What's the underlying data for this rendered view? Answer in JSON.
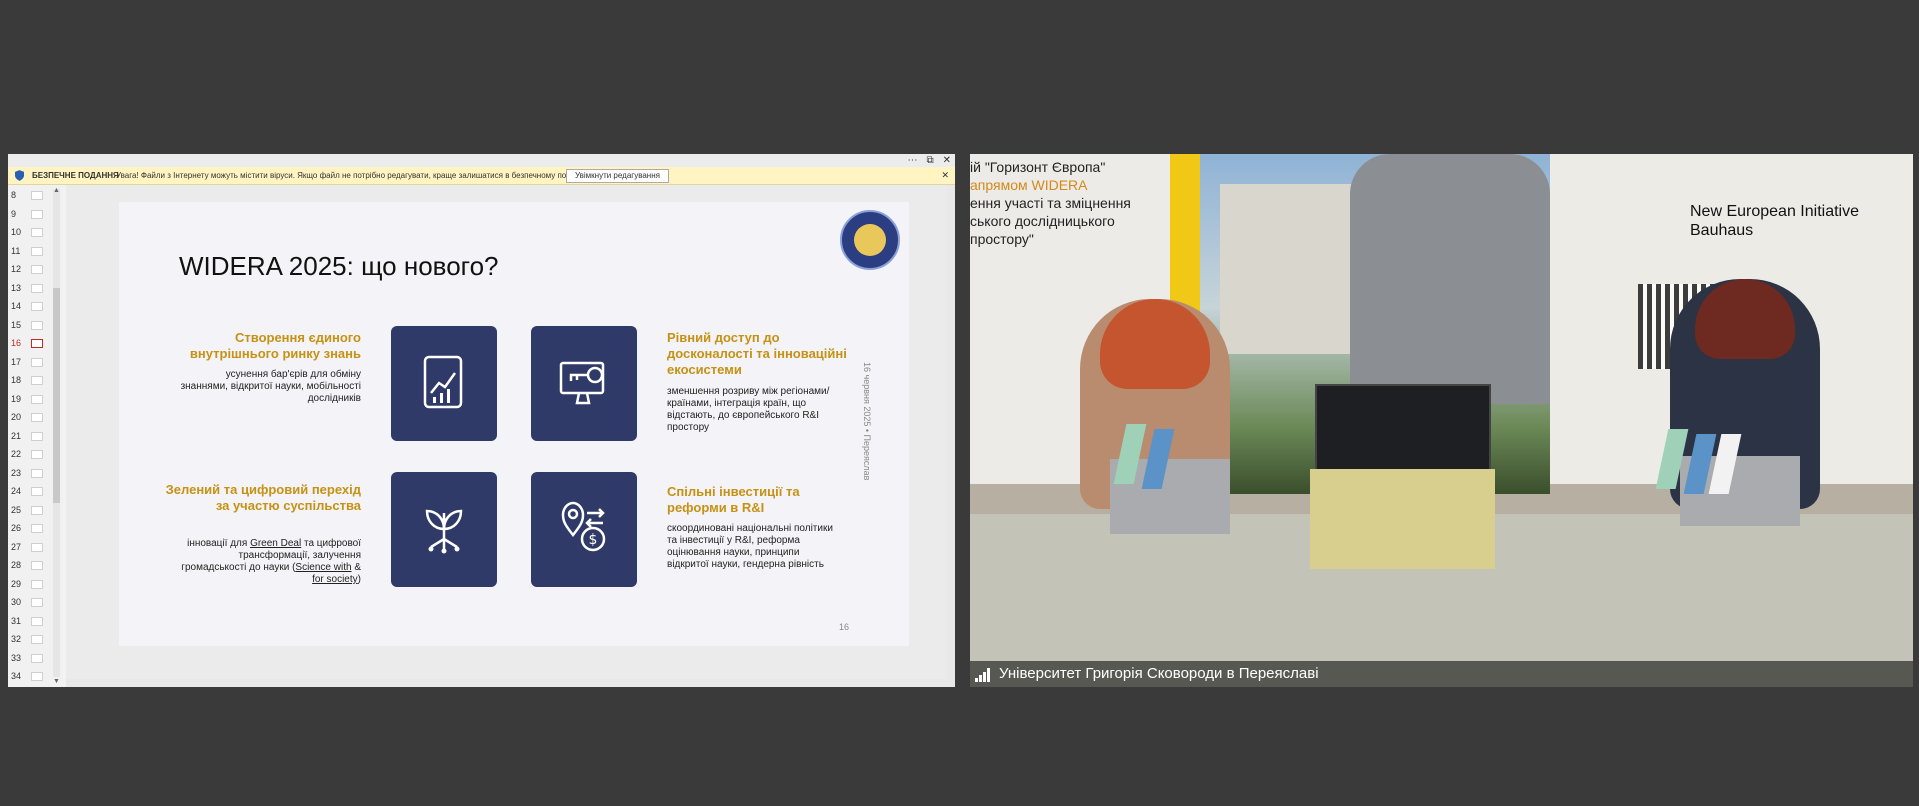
{
  "share": {
    "infobar": {
      "title": "БЕЗПЕЧНЕ ПОДАННЯ",
      "message": "Увага! Файли з Інтернету можуть містити віруси. Якщо файл не потрібно редагувати, краще залишатися в безпечному поданні.",
      "enable_button": "Увімкнути редагування"
    },
    "thumbnails": [
      "8",
      "9",
      "10",
      "11",
      "12",
      "13",
      "14",
      "15",
      "16",
      "17",
      "18",
      "19",
      "20",
      "21",
      "22",
      "23",
      "24",
      "25",
      "26",
      "27",
      "28",
      "29",
      "30",
      "31",
      "32",
      "33",
      "34"
    ],
    "selected_slide": "16",
    "slide": {
      "title": "WIDERA 2025: що нового?",
      "block1_heading": "Створення єдиного внутрішнього ринку знань",
      "block1_text": "усунення бар'єрів для обміну знаннями, відкритої науки, мобільності дослідників",
      "block2_heading": "Рівний доступ до досконалості та інноваційні екосистеми",
      "block2_text": "зменшення розриву між регіонами/країнами, інтеграція країн, що відстають, до європейського R&I простору",
      "block3_heading": "Зелений та цифровий перехід за участю суспільства",
      "block3_text_a": "інновації для ",
      "block3_link1": "Green Deal",
      "block3_text_b": " та цифрової трансформації, залучення громадськості до науки (",
      "block3_link2": "Science with",
      "block3_text_c": " & ",
      "block3_link3": "for society",
      "block3_text_d": ")",
      "block4_heading": "Спільні інвестиції та реформи в R&I",
      "block4_text": "скоординовані національні політики та інвестиції у R&I, реформа оцінювання науки, принципи відкритої науки, гендерна рівність",
      "vertical_note": "16 червня 2025 • Переяслав",
      "page_number": "16"
    }
  },
  "video": {
    "poster_left_lines": [
      "ій \"Горизонт Європа\"",
      "апрямом WIDERA",
      "ення участі та зміцнення",
      "ського дослідницького",
      "простору\""
    ],
    "poster_right": "New European Initiative Bauhaus",
    "caption": "Університет Григорія Сковороди в Переяславі"
  },
  "colors": {
    "tile": "#2f3a68",
    "heading_gold": "#c69214",
    "background": "#3a3a3a"
  }
}
